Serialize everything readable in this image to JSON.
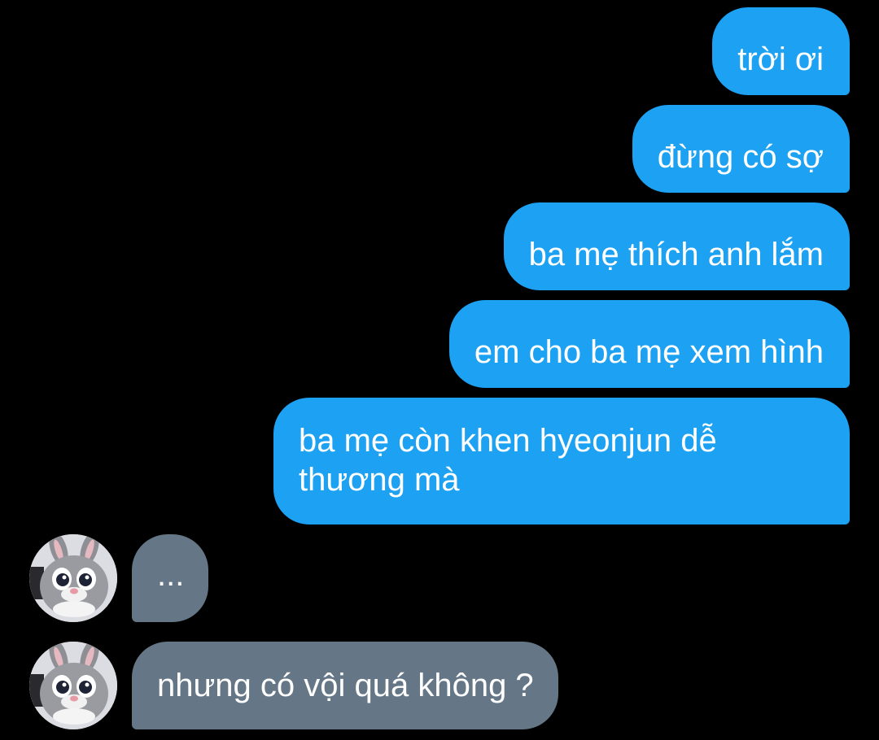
{
  "conversation": {
    "messages": [
      {
        "direction": "outgoing",
        "text": "trời ơi"
      },
      {
        "direction": "outgoing",
        "text": "đừng có sợ"
      },
      {
        "direction": "outgoing",
        "text": "ba mẹ thích anh lắm"
      },
      {
        "direction": "outgoing",
        "text": "em cho ba mẹ xem hình"
      },
      {
        "direction": "outgoing",
        "text": "ba mẹ còn khen hyeonjun dễ thương mà"
      },
      {
        "direction": "incoming",
        "text": "..."
      },
      {
        "direction": "incoming",
        "text": "nhưng có vội quá không ?"
      }
    ],
    "avatar_icon": "bunny-mascot-avatar"
  },
  "colors": {
    "background": "#000000",
    "outgoing_bubble": "#1da1f2",
    "incoming_bubble": "#657786",
    "text": "#ffffff"
  }
}
